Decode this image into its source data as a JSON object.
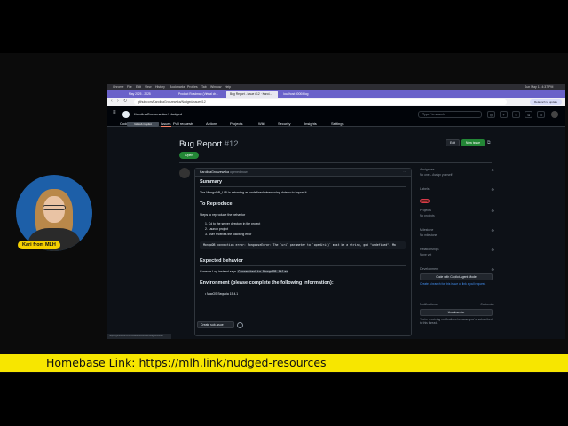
{
  "macbar": {
    "app": "Chrome",
    "menus": [
      "File",
      "Edit",
      "View",
      "History",
      "Bookmarks",
      "Profiles",
      "Tab",
      "Window",
      "Help"
    ],
    "clock": "Sun May 11 4:37 PM"
  },
  "browser": {
    "tabs": [
      "May 2025 - 2025",
      "Product Roadmap (Virtual ch...",
      "Bug Report - issue #12 · KaroI...",
      "localhost:3000/blog"
    ],
    "url": "github.com/KarolinaGroszewska/Nudged/issues/12",
    "relaunch": "Relaunch to update"
  },
  "github": {
    "repo": "KarolinaGroszewska / Nudged",
    "search_placeholder": "Type / to search",
    "code_badge": "GitHub Copilot",
    "nav": [
      "Code",
      "Issues",
      "Pull requests",
      "Actions",
      "Projects",
      "Wiki",
      "Security",
      "Insights",
      "Settings"
    ]
  },
  "issue": {
    "title": "Bug Report",
    "number": "#12",
    "status": "Open",
    "edit": "Edit",
    "new_issue": "New issue",
    "author": "KarolinaGroszewska",
    "opened": "opened now",
    "summary_h": "Summary",
    "summary": "The MongoDB_URI is returning as undefined when using dotenv to import it.",
    "repro_h": "To Reproduce",
    "repro_intro": "Steps to reproduce the behavior",
    "steps": [
      "1. Cd to the server directory in the project",
      "2. Launch project",
      "3. User receives the following error"
    ],
    "error_code": "MongoDB connection error: MongooseError: The `uri` parameter to `openUri()` must be a string, got \"undefined\". Ma",
    "expected_h": "Expected behavior",
    "expected_pre": "Console Log instead says",
    "expected_code": "Connected to MongoDB Atlas",
    "env_h": "Environment (please complete the following information):",
    "env_items": [
      "• MacOS Sequoia 15.4.1"
    ],
    "create_subissue": "Create sub-issue",
    "statusbar": "https://github.com/KarolinaGroszewska/Nudged/issues"
  },
  "sidebar": {
    "assignees_h": "Assignees",
    "assignees_v": "No one – Assign yourself",
    "labels_h": "Labels",
    "label": "bug",
    "projects_h": "Projects",
    "projects_v": "No projects",
    "milestone_h": "Milestone",
    "milestone_v": "No milestone",
    "relationships_h": "Relationships",
    "relationships_v": "None yet",
    "development_h": "Development",
    "copilot_btn": "Code with Copilot Agent Mode",
    "dev_v": "Create a branch for this issue or link a pull request.",
    "notifications_h": "Notifications",
    "customize": "Customize",
    "unsubscribe": "Unsubscribe",
    "notif_v": "You're receiving notifications because you're subscribed to this thread."
  },
  "presenter": {
    "label": "Kari from MLH"
  },
  "banner": {
    "text": "Homebase Link: https://mlh.link/nudged-resources"
  },
  "colors": {
    "banner": "#f7e600",
    "tabbar": "#6a62c9",
    "open_green": "#238636",
    "gh_bg": "#0d1117"
  }
}
